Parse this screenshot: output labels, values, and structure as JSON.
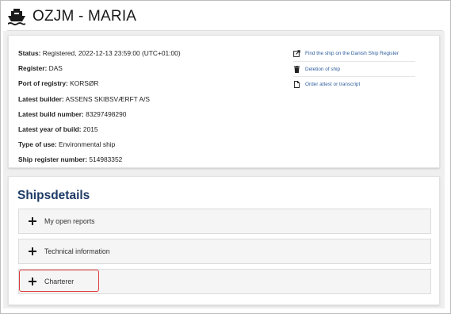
{
  "page": {
    "title": "OZJM - MARIA",
    "title_icon": "ship-icon"
  },
  "info": {
    "rows": [
      {
        "label": "Status:",
        "value": " Registered, 2022-12-13 23:59:00 (UTC+01:00)"
      },
      {
        "label": "Register:",
        "value": " DAS"
      },
      {
        "label": "Port of registry:",
        "value": " KORSØR"
      },
      {
        "label": "Latest builder:",
        "value": " ASSENS SKIBSVÆRFT A/S"
      },
      {
        "label": "Latest build number:",
        "value": " 83297498290"
      },
      {
        "label": "Latest year of build:",
        "value": " 2015"
      },
      {
        "label": "Type of use:",
        "value": " Environmental ship"
      },
      {
        "label": "Ship register number:",
        "value": " 514983352"
      }
    ]
  },
  "links": [
    {
      "label": "Find the ship on the Danish Ship Register",
      "icon": "external-link-icon"
    },
    {
      "label": "Deletion of ship",
      "icon": "trash-icon"
    },
    {
      "label": "Order attest or transcript",
      "icon": "document-icon"
    }
  ],
  "details": {
    "title": "Shipsdetails",
    "sections": [
      {
        "label": "My open reports"
      },
      {
        "label": "Technical information"
      },
      {
        "label": "Charterer"
      }
    ]
  },
  "colors": {
    "link": "#2f5f9e",
    "heading": "#1e3a66",
    "highlight": "#e03a3a"
  }
}
